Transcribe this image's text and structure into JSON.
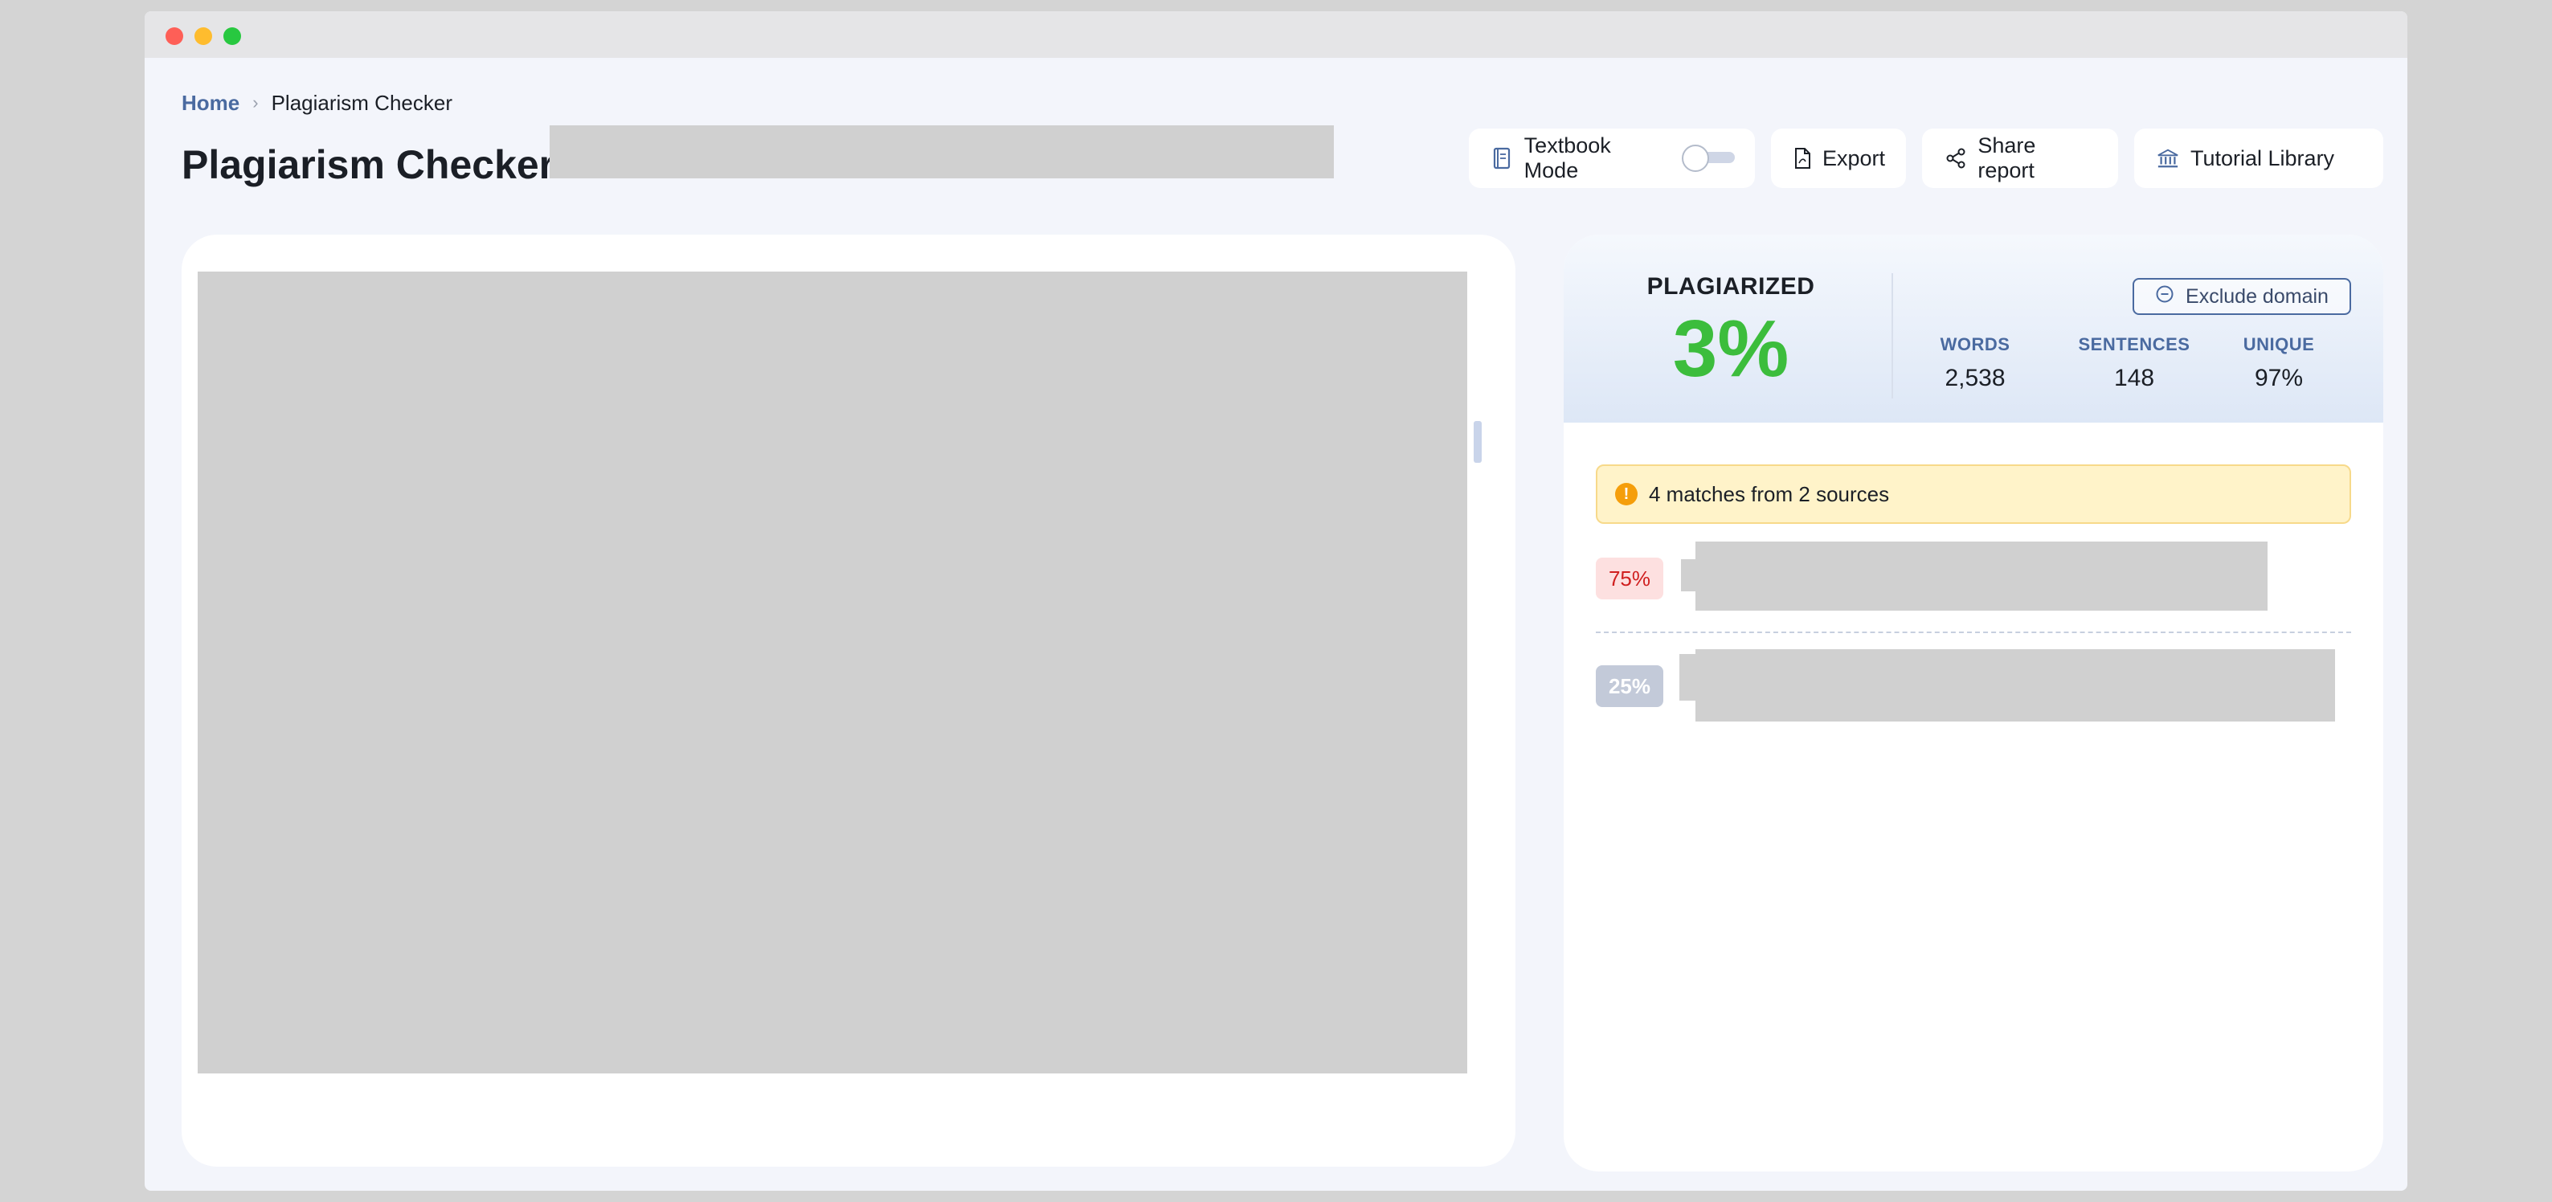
{
  "window": {
    "controls": [
      "close",
      "minimize",
      "maximize"
    ]
  },
  "breadcrumb": {
    "home": "Home",
    "current": "Plagiarism Checker"
  },
  "page": {
    "title": "Plagiarism Checker:"
  },
  "toolbar": {
    "textbook_mode": {
      "label": "Textbook Mode",
      "icon": "book-icon",
      "enabled": false
    },
    "export": {
      "label": "Export",
      "icon": "pdf-file-icon"
    },
    "share": {
      "label": "Share report",
      "icon": "share-icon"
    },
    "tutorial": {
      "label": "Tutorial Library",
      "icon": "library-icon"
    }
  },
  "summary": {
    "plagiarized_label": "PLAGIARIZED",
    "plagiarized_value": "3%",
    "stats": [
      {
        "label": "WORDS",
        "value": "2,538"
      },
      {
        "label": "SENTENCES",
        "value": "148"
      },
      {
        "label": "UNIQUE",
        "value": "97%"
      }
    ],
    "exclude_label": "Exclude domain"
  },
  "alert": {
    "text": "4 matches from 2 sources",
    "icon": "warning-icon"
  },
  "matches": [
    {
      "percent": "75%"
    },
    {
      "percent": "25%"
    }
  ],
  "colors": {
    "accent": "#4a6aa0",
    "plagiarized": "#3cbd3c",
    "alert_bg": "#fff3c9",
    "match_high": "#d02020"
  }
}
